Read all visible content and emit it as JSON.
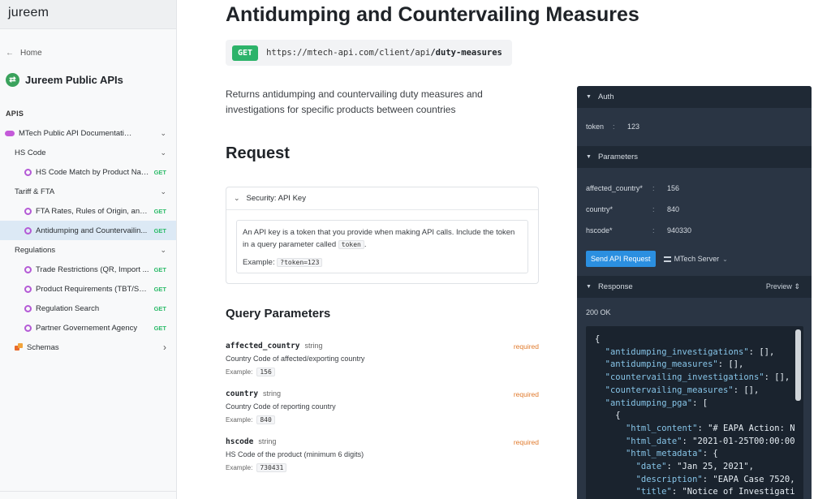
{
  "sidebar": {
    "brand": "jureem",
    "home_label": "Home",
    "project_title": "Jureem Public APIs",
    "apis_label": "APIS",
    "items": [
      {
        "label": "MTech Public API Documentation",
        "level": 0,
        "icon": "cloud-icon",
        "chevron": "⌄"
      },
      {
        "label": "HS Code",
        "level": 1,
        "chevron": "⌄"
      },
      {
        "label": "HS Code Match by Product Name",
        "level": 2,
        "icon": "endpoint-icon",
        "method": "GET"
      },
      {
        "label": "Tariff & FTA",
        "level": 1,
        "chevron": "⌄"
      },
      {
        "label": "FTA Rates, Rules of Origin, and ...",
        "level": 2,
        "icon": "endpoint-icon",
        "method": "GET"
      },
      {
        "label": "Antidumping and Countervailin...",
        "level": 2,
        "icon": "endpoint-icon",
        "method": "GET",
        "active": true
      },
      {
        "label": "Regulations",
        "level": 1,
        "chevron": "⌄"
      },
      {
        "label": "Trade Restrictions (QR, Import ...",
        "level": 2,
        "icon": "endpoint-icon",
        "method": "GET"
      },
      {
        "label": "Product Requirements (TBT/SPS)",
        "level": 2,
        "icon": "endpoint-icon",
        "method": "GET"
      },
      {
        "label": "Regulation Search",
        "level": 2,
        "icon": "endpoint-icon",
        "method": "GET"
      },
      {
        "label": "Partner Governement Agency",
        "level": 2,
        "icon": "endpoint-icon",
        "method": "GET"
      },
      {
        "label": "Schemas",
        "level": 0,
        "icon": "schema-icon",
        "chevron": "›"
      }
    ]
  },
  "main": {
    "title": "Antidumping and Countervailing Measures",
    "method": "GET",
    "url_base": "https://mtech-api.com/client/api",
    "url_path": "/duty-measures",
    "description": "Returns antidumping and countervailing duty measures and investigations for specific products between countries",
    "request_heading": "Request",
    "security": {
      "title": "Security: API Key",
      "text_before": "An API key is a token that you provide when making API calls. Include the token in a query parameter called",
      "token_chip": "token",
      "text_after": ".",
      "example_label": "Example:",
      "example_value": "?token=123"
    },
    "query_heading": "Query Parameters",
    "params": [
      {
        "name": "affected_country",
        "type": "string",
        "required": "required",
        "description": "Country Code of affected/exporting country",
        "example_label": "Example:",
        "example": "156"
      },
      {
        "name": "country",
        "type": "string",
        "required": "required",
        "description": "Country Code of reporting country",
        "example_label": "Example:",
        "example": "840"
      },
      {
        "name": "hscode",
        "type": "string",
        "required": "required",
        "description": "HS Code of the product (minimum 6 digits)",
        "example_label": "Example:",
        "example": "730431"
      }
    ]
  },
  "panel": {
    "auth_label": "Auth",
    "token_key": "token",
    "token_value": "123",
    "parameters_label": "Parameters",
    "params": [
      {
        "key": "affected_country*",
        "value": "156"
      },
      {
        "key": "country*",
        "value": "840"
      },
      {
        "key": "hscode*",
        "value": "940330"
      }
    ],
    "send_label": "Send API Request",
    "server_label": "MTech Server",
    "response_label": "Response",
    "preview_label": "Preview",
    "status": "200 OK",
    "json_lines": [
      "{",
      "  \"antidumping_investigations\": [],",
      "  \"antidumping_measures\": [],",
      "  \"countervailing_investigations\": [],",
      "  \"countervailing_measures\": [],",
      "  \"antidumping_pga\": [",
      "    {",
      "      \"html_content\": \"# EAPA Action: N",
      "      \"html_date\": \"2021-01-25T00:00:00",
      "      \"html_metadata\": {",
      "        \"date\": \"Jan 25, 2021\",",
      "        \"description\": \"EAPA Case 7520,",
      "        \"title\": \"Notice of Investigati"
    ]
  },
  "colors": {
    "accent": "#2b8fe0",
    "get_badge": "#2db36a",
    "required": "#e07a2c",
    "active_nav": "#dce9f5",
    "panel_bg": "#2a3544"
  }
}
